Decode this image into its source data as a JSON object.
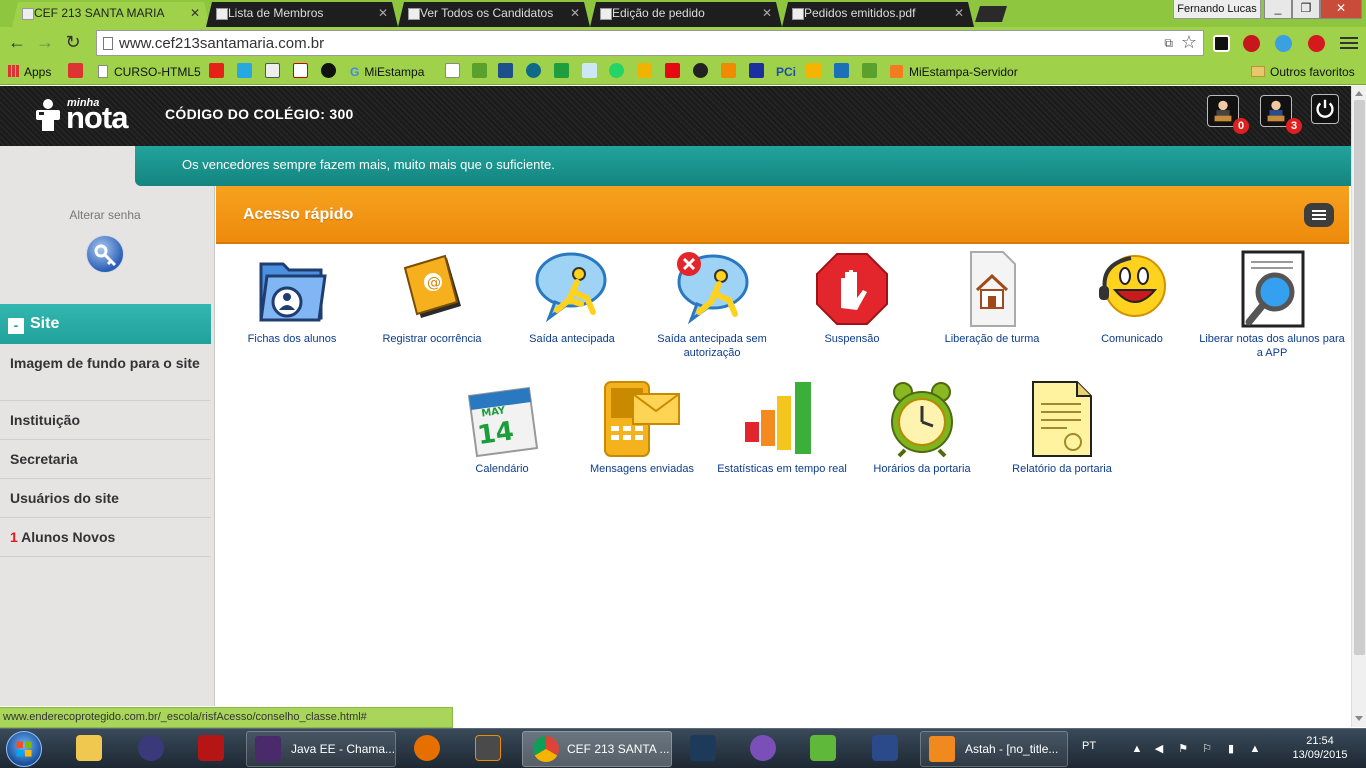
{
  "browser": {
    "tabs": [
      {
        "label": "CEF 213 SANTA MARIA",
        "active": true
      },
      {
        "label": "Lista de Membros",
        "active": false
      },
      {
        "label": "Ver Todos os Candidatos",
        "active": false
      },
      {
        "label": "Edição de pedido",
        "active": false
      },
      {
        "label": "Pedidos emitidos.pdf",
        "active": false
      }
    ],
    "profile": "Fernando Lucas",
    "url": "www.cef213santamaria.com.br",
    "bookmarks": {
      "apps": "Apps",
      "curso": "CURSO-HTML5",
      "miestampa": "MiEstampa",
      "pci": "PCi",
      "miestampa_servidor": "MiEstampa-Servidor",
      "outros": "Outros favoritos"
    },
    "status_url": "www.enderecoprotegido.com.br/_escola/risfAcesso/conselho_classe.html#"
  },
  "header": {
    "logo_small": "minha",
    "logo_big": "nota",
    "school_code": "CÓDIGO DO COLÉGIO: 300",
    "badge_1": "0",
    "badge_2": "3"
  },
  "motto": "Os vencedores sempre fazem mais, muito mais que o suficiente.",
  "sidebar": {
    "change_password": "Alterar senha",
    "section_toggle": "-",
    "section": "Site",
    "items": [
      {
        "label": "Imagem de fundo para o site"
      },
      {
        "label": "Instituição"
      },
      {
        "label": "Secretaria"
      },
      {
        "label": "Usuários do site"
      },
      {
        "count": "1",
        "label": "Alunos Novos"
      }
    ]
  },
  "quick_access": {
    "title": "Acesso rápido",
    "row1": [
      {
        "label": "Fichas dos alunos",
        "icon": "folder-user-icon"
      },
      {
        "label": "Registrar ocorrência",
        "icon": "address-book-icon"
      },
      {
        "label": "Saída antecipada",
        "icon": "running-chat-icon"
      },
      {
        "label": "Saída antecipada sem autorização",
        "icon": "running-chat-error-icon"
      },
      {
        "label": "Suspensão",
        "icon": "stop-hand-icon"
      },
      {
        "label": "Liberação de turma",
        "icon": "house-document-icon"
      },
      {
        "label": "Comunicado",
        "icon": "smiley-headset-icon"
      },
      {
        "label": "Liberar notas dos alunos para a APP",
        "icon": "magnifier-document-icon"
      }
    ],
    "row2": [
      {
        "label": "Calendário",
        "icon": "calendar-icon",
        "cal_month": "MAY",
        "cal_day": "14"
      },
      {
        "label": "Mensagens enviadas",
        "icon": "phone-mail-icon"
      },
      {
        "label": "Estatísticas em tempo real",
        "icon": "bar-chart-icon"
      },
      {
        "label": "Horários da portaria",
        "icon": "alarm-clock-icon"
      },
      {
        "label": "Relatório da portaria",
        "icon": "report-document-icon"
      }
    ]
  },
  "taskbar": {
    "buttons": [
      {
        "label": "Java EE - Chama..."
      },
      {
        "label": "CEF 213 SANTA ..."
      },
      {
        "label": "Astah - [no_title..."
      }
    ],
    "lang": "PT",
    "time": "21:54",
    "date": "13/09/2015"
  }
}
